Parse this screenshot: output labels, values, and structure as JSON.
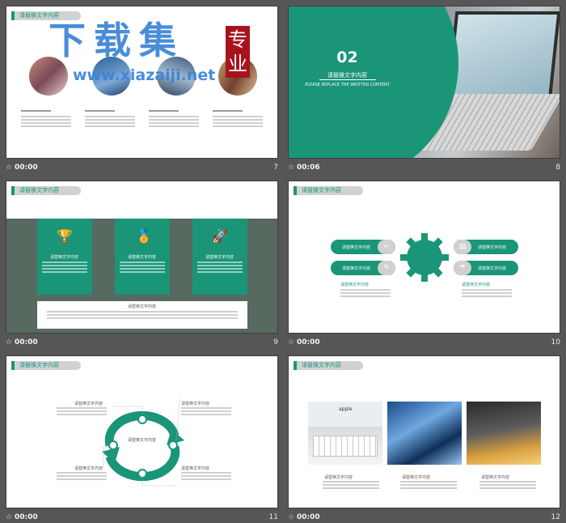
{
  "watermark": {
    "main": "下载集",
    "badge": "专业",
    "url": "www.xiazaiji.net"
  },
  "slide_label": "请替换文字内容",
  "cells": [
    {
      "time": "00:00",
      "num": "7"
    },
    {
      "time": "00:06",
      "num": "8"
    },
    {
      "time": "00:00",
      "num": "9"
    },
    {
      "time": "00:00",
      "num": "10"
    },
    {
      "time": "00:00",
      "num": "11"
    },
    {
      "time": "00:00",
      "num": "12"
    }
  ],
  "slide8": {
    "number": "02",
    "title": "请替换文字内容",
    "subtitle": "PLEASE REPLACE THE WRITTEN CONTENT"
  },
  "slide9": {
    "box_title": "请替换文字内容",
    "bottom_title": "请替换文字内容"
  },
  "slide10": {
    "pill": "请替换文字内容",
    "caption": "请替换文字内容"
  },
  "slide11": {
    "caption": "请替换文字内容"
  },
  "slide12": {
    "caption": "请替换文字内容",
    "photo_brand": "apple"
  },
  "colors": {
    "accent": "#1a9577",
    "background": "#565656",
    "footer_text": "#f2f2f2"
  },
  "icons": [
    "trophy-icon",
    "medal-icon",
    "rocket-icon",
    "wrench-icon",
    "pencil-icon",
    "document-icon",
    "umbrella-icon",
    "star-icon"
  ]
}
